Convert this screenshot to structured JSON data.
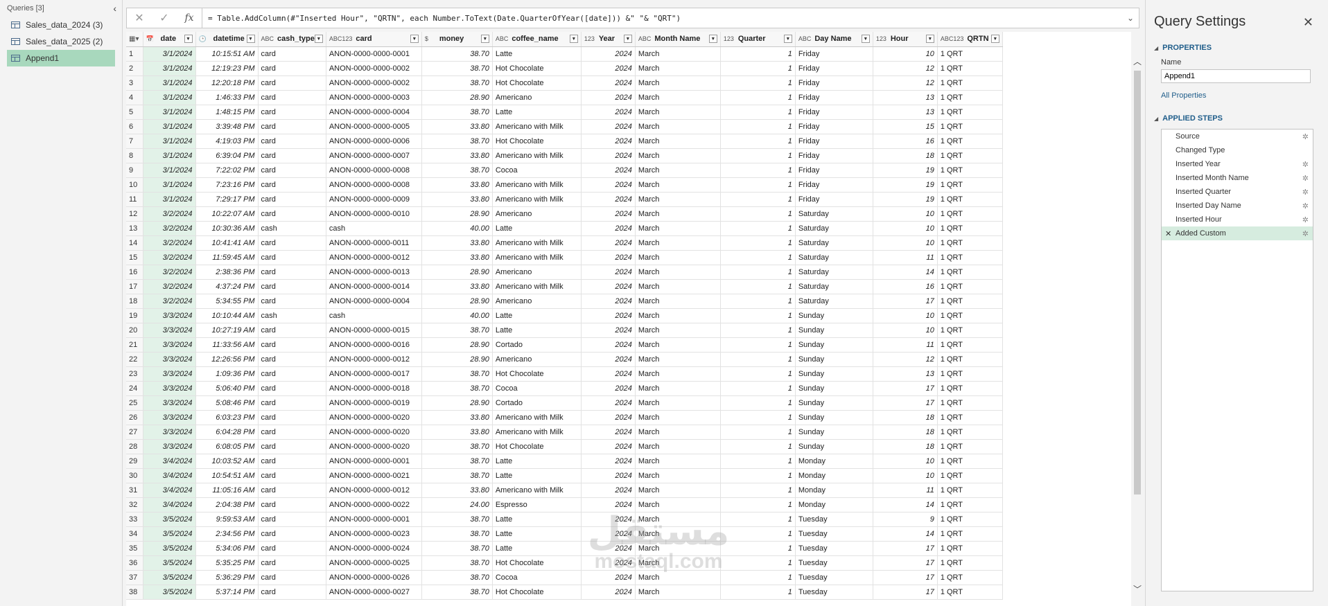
{
  "queries_pane": {
    "header": "Queries [3]",
    "items": [
      {
        "label": "Sales_data_2024 (3)",
        "active": false
      },
      {
        "label": "Sales_data_2025 (2)",
        "active": false
      },
      {
        "label": "Append1",
        "active": true
      }
    ]
  },
  "formula_bar": {
    "cancel_icon": "close-icon",
    "commit_icon": "check-icon",
    "fx_label": "fx",
    "formula": "= Table.AddColumn(#\"Inserted Hour\", \"QRTN\", each Number.ToText(Date.QuarterOfYear([date])) &\" \"& \"QRT\")"
  },
  "grid": {
    "columns": [
      {
        "type": "📅",
        "name": "date"
      },
      {
        "type": "🕒",
        "name": "datetime"
      },
      {
        "type": "ABC",
        "name": "cash_type"
      },
      {
        "type": "ABC123",
        "name": "card"
      },
      {
        "type": "$",
        "name": "money"
      },
      {
        "type": "ABC",
        "name": "coffee_name"
      },
      {
        "type": "123",
        "name": "Year"
      },
      {
        "type": "ABC",
        "name": "Month Name"
      },
      {
        "type": "123",
        "name": "Quarter"
      },
      {
        "type": "ABC",
        "name": "Day Name"
      },
      {
        "type": "123",
        "name": "Hour"
      },
      {
        "type": "ABC123",
        "name": "QRTN"
      }
    ],
    "rows": [
      [
        "1",
        "3/1/2024",
        "10:15:51 AM",
        "card",
        "ANON-0000-0000-0001",
        "38.70",
        "Latte",
        "2024",
        "March",
        "1",
        "Friday",
        "10",
        "1 QRT"
      ],
      [
        "2",
        "3/1/2024",
        "12:19:23 PM",
        "card",
        "ANON-0000-0000-0002",
        "38.70",
        "Hot Chocolate",
        "2024",
        "March",
        "1",
        "Friday",
        "12",
        "1 QRT"
      ],
      [
        "3",
        "3/1/2024",
        "12:20:18 PM",
        "card",
        "ANON-0000-0000-0002",
        "38.70",
        "Hot Chocolate",
        "2024",
        "March",
        "1",
        "Friday",
        "12",
        "1 QRT"
      ],
      [
        "4",
        "3/1/2024",
        "1:46:33 PM",
        "card",
        "ANON-0000-0000-0003",
        "28.90",
        "Americano",
        "2024",
        "March",
        "1",
        "Friday",
        "13",
        "1 QRT"
      ],
      [
        "5",
        "3/1/2024",
        "1:48:15 PM",
        "card",
        "ANON-0000-0000-0004",
        "38.70",
        "Latte",
        "2024",
        "March",
        "1",
        "Friday",
        "13",
        "1 QRT"
      ],
      [
        "6",
        "3/1/2024",
        "3:39:48 PM",
        "card",
        "ANON-0000-0000-0005",
        "33.80",
        "Americano with Milk",
        "2024",
        "March",
        "1",
        "Friday",
        "15",
        "1 QRT"
      ],
      [
        "7",
        "3/1/2024",
        "4:19:03 PM",
        "card",
        "ANON-0000-0000-0006",
        "38.70",
        "Hot Chocolate",
        "2024",
        "March",
        "1",
        "Friday",
        "16",
        "1 QRT"
      ],
      [
        "8",
        "3/1/2024",
        "6:39:04 PM",
        "card",
        "ANON-0000-0000-0007",
        "33.80",
        "Americano with Milk",
        "2024",
        "March",
        "1",
        "Friday",
        "18",
        "1 QRT"
      ],
      [
        "9",
        "3/1/2024",
        "7:22:02 PM",
        "card",
        "ANON-0000-0000-0008",
        "38.70",
        "Cocoa",
        "2024",
        "March",
        "1",
        "Friday",
        "19",
        "1 QRT"
      ],
      [
        "10",
        "3/1/2024",
        "7:23:16 PM",
        "card",
        "ANON-0000-0000-0008",
        "33.80",
        "Americano with Milk",
        "2024",
        "March",
        "1",
        "Friday",
        "19",
        "1 QRT"
      ],
      [
        "11",
        "3/1/2024",
        "7:29:17 PM",
        "card",
        "ANON-0000-0000-0009",
        "33.80",
        "Americano with Milk",
        "2024",
        "March",
        "1",
        "Friday",
        "19",
        "1 QRT"
      ],
      [
        "12",
        "3/2/2024",
        "10:22:07 AM",
        "card",
        "ANON-0000-0000-0010",
        "28.90",
        "Americano",
        "2024",
        "March",
        "1",
        "Saturday",
        "10",
        "1 QRT"
      ],
      [
        "13",
        "3/2/2024",
        "10:30:36 AM",
        "cash",
        "cash",
        "40.00",
        "Latte",
        "2024",
        "March",
        "1",
        "Saturday",
        "10",
        "1 QRT"
      ],
      [
        "14",
        "3/2/2024",
        "10:41:41 AM",
        "card",
        "ANON-0000-0000-0011",
        "33.80",
        "Americano with Milk",
        "2024",
        "March",
        "1",
        "Saturday",
        "10",
        "1 QRT"
      ],
      [
        "15",
        "3/2/2024",
        "11:59:45 AM",
        "card",
        "ANON-0000-0000-0012",
        "33.80",
        "Americano with Milk",
        "2024",
        "March",
        "1",
        "Saturday",
        "11",
        "1 QRT"
      ],
      [
        "16",
        "3/2/2024",
        "2:38:36 PM",
        "card",
        "ANON-0000-0000-0013",
        "28.90",
        "Americano",
        "2024",
        "March",
        "1",
        "Saturday",
        "14",
        "1 QRT"
      ],
      [
        "17",
        "3/2/2024",
        "4:37:24 PM",
        "card",
        "ANON-0000-0000-0014",
        "33.80",
        "Americano with Milk",
        "2024",
        "March",
        "1",
        "Saturday",
        "16",
        "1 QRT"
      ],
      [
        "18",
        "3/2/2024",
        "5:34:55 PM",
        "card",
        "ANON-0000-0000-0004",
        "28.90",
        "Americano",
        "2024",
        "March",
        "1",
        "Saturday",
        "17",
        "1 QRT"
      ],
      [
        "19",
        "3/3/2024",
        "10:10:44 AM",
        "cash",
        "cash",
        "40.00",
        "Latte",
        "2024",
        "March",
        "1",
        "Sunday",
        "10",
        "1 QRT"
      ],
      [
        "20",
        "3/3/2024",
        "10:27:19 AM",
        "card",
        "ANON-0000-0000-0015",
        "38.70",
        "Latte",
        "2024",
        "March",
        "1",
        "Sunday",
        "10",
        "1 QRT"
      ],
      [
        "21",
        "3/3/2024",
        "11:33:56 AM",
        "card",
        "ANON-0000-0000-0016",
        "28.90",
        "Cortado",
        "2024",
        "March",
        "1",
        "Sunday",
        "11",
        "1 QRT"
      ],
      [
        "22",
        "3/3/2024",
        "12:26:56 PM",
        "card",
        "ANON-0000-0000-0012",
        "28.90",
        "Americano",
        "2024",
        "March",
        "1",
        "Sunday",
        "12",
        "1 QRT"
      ],
      [
        "23",
        "3/3/2024",
        "1:09:36 PM",
        "card",
        "ANON-0000-0000-0017",
        "38.70",
        "Hot Chocolate",
        "2024",
        "March",
        "1",
        "Sunday",
        "13",
        "1 QRT"
      ],
      [
        "24",
        "3/3/2024",
        "5:06:40 PM",
        "card",
        "ANON-0000-0000-0018",
        "38.70",
        "Cocoa",
        "2024",
        "March",
        "1",
        "Sunday",
        "17",
        "1 QRT"
      ],
      [
        "25",
        "3/3/2024",
        "5:08:46 PM",
        "card",
        "ANON-0000-0000-0019",
        "28.90",
        "Cortado",
        "2024",
        "March",
        "1",
        "Sunday",
        "17",
        "1 QRT"
      ],
      [
        "26",
        "3/3/2024",
        "6:03:23 PM",
        "card",
        "ANON-0000-0000-0020",
        "33.80",
        "Americano with Milk",
        "2024",
        "March",
        "1",
        "Sunday",
        "18",
        "1 QRT"
      ],
      [
        "27",
        "3/3/2024",
        "6:04:28 PM",
        "card",
        "ANON-0000-0000-0020",
        "33.80",
        "Americano with Milk",
        "2024",
        "March",
        "1",
        "Sunday",
        "18",
        "1 QRT"
      ],
      [
        "28",
        "3/3/2024",
        "6:08:05 PM",
        "card",
        "ANON-0000-0000-0020",
        "38.70",
        "Hot Chocolate",
        "2024",
        "March",
        "1",
        "Sunday",
        "18",
        "1 QRT"
      ],
      [
        "29",
        "3/4/2024",
        "10:03:52 AM",
        "card",
        "ANON-0000-0000-0001",
        "38.70",
        "Latte",
        "2024",
        "March",
        "1",
        "Monday",
        "10",
        "1 QRT"
      ],
      [
        "30",
        "3/4/2024",
        "10:54:51 AM",
        "card",
        "ANON-0000-0000-0021",
        "38.70",
        "Latte",
        "2024",
        "March",
        "1",
        "Monday",
        "10",
        "1 QRT"
      ],
      [
        "31",
        "3/4/2024",
        "11:05:16 AM",
        "card",
        "ANON-0000-0000-0012",
        "33.80",
        "Americano with Milk",
        "2024",
        "March",
        "1",
        "Monday",
        "11",
        "1 QRT"
      ],
      [
        "32",
        "3/4/2024",
        "2:04:38 PM",
        "card",
        "ANON-0000-0000-0022",
        "24.00",
        "Espresso",
        "2024",
        "March",
        "1",
        "Monday",
        "14",
        "1 QRT"
      ],
      [
        "33",
        "3/5/2024",
        "9:59:53 AM",
        "card",
        "ANON-0000-0000-0001",
        "38.70",
        "Latte",
        "2024",
        "March",
        "1",
        "Tuesday",
        "9",
        "1 QRT"
      ],
      [
        "34",
        "3/5/2024",
        "2:34:56 PM",
        "card",
        "ANON-0000-0000-0023",
        "38.70",
        "Latte",
        "2024",
        "March",
        "1",
        "Tuesday",
        "14",
        "1 QRT"
      ],
      [
        "35",
        "3/5/2024",
        "5:34:06 PM",
        "card",
        "ANON-0000-0000-0024",
        "38.70",
        "Latte",
        "2024",
        "March",
        "1",
        "Tuesday",
        "17",
        "1 QRT"
      ],
      [
        "36",
        "3/5/2024",
        "5:35:25 PM",
        "card",
        "ANON-0000-0000-0025",
        "38.70",
        "Hot Chocolate",
        "2024",
        "March",
        "1",
        "Tuesday",
        "17",
        "1 QRT"
      ],
      [
        "37",
        "3/5/2024",
        "5:36:29 PM",
        "card",
        "ANON-0000-0000-0026",
        "38.70",
        "Cocoa",
        "2024",
        "March",
        "1",
        "Tuesday",
        "17",
        "1 QRT"
      ],
      [
        "38",
        "3/5/2024",
        "5:37:14 PM",
        "card",
        "ANON-0000-0000-0027",
        "38.70",
        "Hot Chocolate",
        "2024",
        "March",
        "1",
        "Tuesday",
        "17",
        "1 QRT"
      ]
    ]
  },
  "settings": {
    "title": "Query Settings",
    "properties_header": "PROPERTIES",
    "name_label": "Name",
    "name_value": "Append1",
    "all_properties": "All Properties",
    "steps_header": "APPLIED STEPS",
    "steps": [
      {
        "label": "Source",
        "gear": true,
        "active": false
      },
      {
        "label": "Changed Type",
        "gear": false,
        "active": false
      },
      {
        "label": "Inserted Year",
        "gear": true,
        "active": false
      },
      {
        "label": "Inserted Month Name",
        "gear": true,
        "active": false
      },
      {
        "label": "Inserted Quarter",
        "gear": true,
        "active": false
      },
      {
        "label": "Inserted Day Name",
        "gear": true,
        "active": false
      },
      {
        "label": "Inserted Hour",
        "gear": true,
        "active": false
      },
      {
        "label": "Added Custom",
        "gear": true,
        "active": true
      }
    ]
  },
  "watermark": {
    "arabic": "مستقل",
    "latin": "mostaql.com"
  }
}
